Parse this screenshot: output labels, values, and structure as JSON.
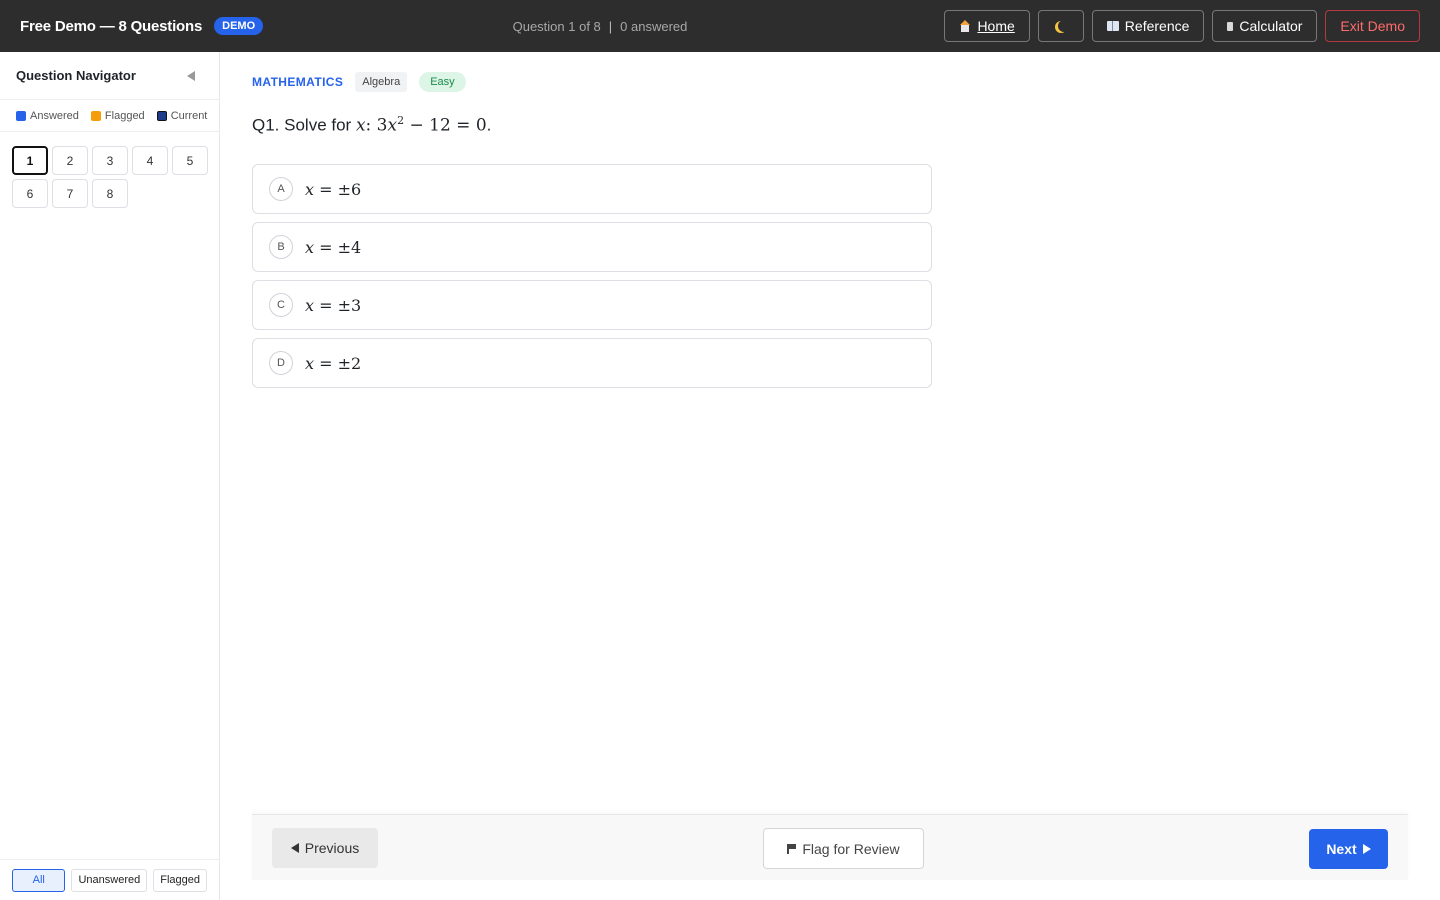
{
  "header": {
    "title": "Free Demo — 8 Questions",
    "badge": "DEMO",
    "progress_question": "Question 1 of 8",
    "progress_separator": "|",
    "progress_answered": "0 answered",
    "buttons": {
      "home": "Home",
      "reference": "Reference",
      "calculator": "Calculator",
      "exit": "Exit Demo"
    },
    "icons": {
      "home": "home-icon",
      "theme": "moon-icon",
      "reference": "book-icon",
      "calculator": "calculator-icon"
    }
  },
  "sidebar": {
    "title": "Question Navigator",
    "legend": {
      "answered": "Answered",
      "flagged": "Flagged",
      "current": "Current"
    },
    "legend_colors": {
      "answered": "#2563eb",
      "flagged": "#f59e0b",
      "current": "#1e3a8a"
    },
    "questions": [
      "1",
      "2",
      "3",
      "4",
      "5",
      "6",
      "7",
      "8"
    ],
    "current_question": "1",
    "filters": {
      "all": "All",
      "unanswered": "Unanswered",
      "flagged": "Flagged"
    },
    "active_filter": "All"
  },
  "question": {
    "subject": "MATHEMATICS",
    "topic": "Algebra",
    "difficulty": "Easy",
    "number_prefix": "Q1. Solve for ",
    "math_var": "𝑥",
    "colon": ":",
    "math_eq_part1": " 3𝑥",
    "math_exponent": "2",
    "math_eq_part2": " − 12 = 0",
    "end": ".",
    "options": [
      {
        "letter": "A",
        "text": "𝑥 = ±6"
      },
      {
        "letter": "B",
        "text": "𝑥 = ±4"
      },
      {
        "letter": "C",
        "text": "𝑥 = ±3"
      },
      {
        "letter": "D",
        "text": "𝑥 = ±2"
      }
    ]
  },
  "navigation": {
    "previous": "Previous",
    "flag": "Flag for Review",
    "next": "Next"
  },
  "colors": {
    "topbar_bg": "#2d2d2d",
    "accent": "#2563eb",
    "exit": "#ff6b6b",
    "easy_bg": "#dcf5e6",
    "easy_text": "#1b8a4b"
  }
}
